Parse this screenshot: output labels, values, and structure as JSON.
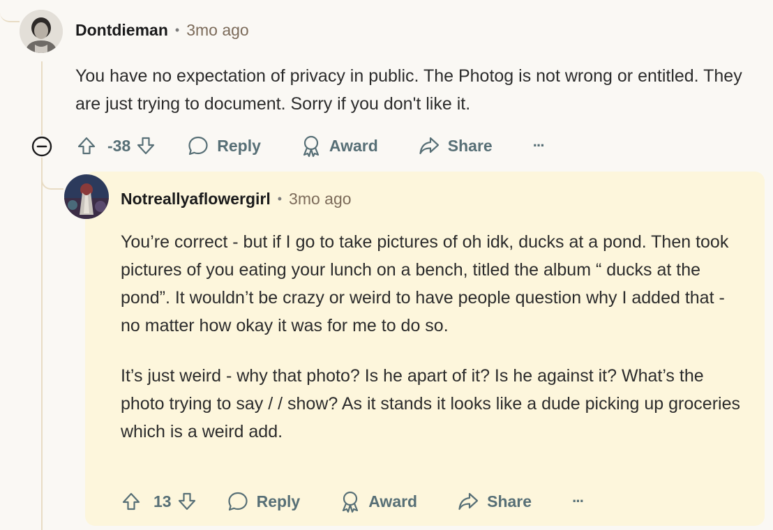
{
  "comment1": {
    "author": "Dontdieman",
    "time": "3mo ago",
    "body": "You have no expectation of privacy in public. The Photog is not wrong or entitled. They are just trying to document. Sorry if you don't like it.",
    "votes": "-38",
    "reply_label": "Reply",
    "award_label": "Award",
    "share_label": "Share",
    "more_label": "···"
  },
  "comment2": {
    "author": "Notreallyaflowergirl",
    "time": "3mo ago",
    "body_p1": "You’re correct - but if I go to take pictures of oh idk, ducks at a pond. Then took pictures of you eating your lunch on a bench, titled the album “ ducks at the pond”. It wouldn’t be crazy or weird to have people question why I added that - no matter how okay it was for me to do so.",
    "body_p2": "It’s just weird - why that photo? Is he apart of it? Is he against it? What’s the photo trying to say / / show? As it stands it looks like a dude picking up groceries which is a weird add.",
    "votes": "13",
    "reply_label": "Reply",
    "award_label": "Award",
    "share_label": "Share",
    "more_label": "···"
  },
  "icons": [
    "collapse-icon",
    "upvote-icon",
    "downvote-icon",
    "reply-icon",
    "award-icon",
    "share-icon",
    "more-icon"
  ],
  "colors": {
    "thread_line": "#e8dcc4",
    "reply_highlight": "#fdf6dc",
    "action_text": "#576f76",
    "timestamp": "#7c6b5a"
  }
}
